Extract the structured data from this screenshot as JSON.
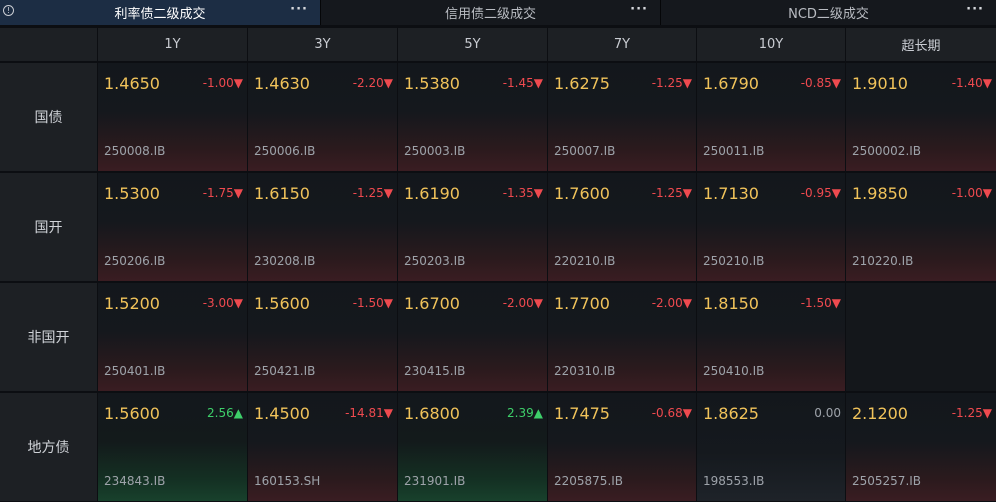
{
  "tabs": [
    {
      "label": "利率债二级成交",
      "active": true
    },
    {
      "label": "信用债二级成交",
      "active": false
    },
    {
      "label": "NCD二级成交",
      "active": false
    }
  ],
  "more_label": "···",
  "info_label": "!",
  "columns": [
    "1Y",
    "3Y",
    "5Y",
    "7Y",
    "10Y",
    "超长期"
  ],
  "rows": [
    {
      "label": "国债",
      "cells": [
        {
          "price": "1.4650",
          "change": "-1.00▼",
          "code": "250008.IB",
          "dir": "down"
        },
        {
          "price": "1.4630",
          "change": "-2.20▼",
          "code": "250006.IB",
          "dir": "down"
        },
        {
          "price": "1.5380",
          "change": "-1.45▼",
          "code": "250003.IB",
          "dir": "down"
        },
        {
          "price": "1.6275",
          "change": "-1.25▼",
          "code": "250007.IB",
          "dir": "down"
        },
        {
          "price": "1.6790",
          "change": "-0.85▼",
          "code": "250011.IB",
          "dir": "down"
        },
        {
          "price": "1.9010",
          "change": "-1.40▼",
          "code": "2500002.IB",
          "dir": "down"
        }
      ]
    },
    {
      "label": "国开",
      "cells": [
        {
          "price": "1.5300",
          "change": "-1.75▼",
          "code": "250206.IB",
          "dir": "down"
        },
        {
          "price": "1.6150",
          "change": "-1.25▼",
          "code": "230208.IB",
          "dir": "down"
        },
        {
          "price": "1.6190",
          "change": "-1.35▼",
          "code": "250203.IB",
          "dir": "down"
        },
        {
          "price": "1.7600",
          "change": "-1.25▼",
          "code": "220210.IB",
          "dir": "down"
        },
        {
          "price": "1.7130",
          "change": "-0.95▼",
          "code": "250210.IB",
          "dir": "down"
        },
        {
          "price": "1.9850",
          "change": "-1.00▼",
          "code": "210220.IB",
          "dir": "down"
        }
      ]
    },
    {
      "label": "非国开",
      "cells": [
        {
          "price": "1.5200",
          "change": "-3.00▼",
          "code": "250401.IB",
          "dir": "down"
        },
        {
          "price": "1.5600",
          "change": "-1.50▼",
          "code": "250421.IB",
          "dir": "down"
        },
        {
          "price": "1.6700",
          "change": "-2.00▼",
          "code": "230415.IB",
          "dir": "down"
        },
        {
          "price": "1.7700",
          "change": "-2.00▼",
          "code": "220310.IB",
          "dir": "down"
        },
        {
          "price": "1.8150",
          "change": "-1.50▼",
          "code": "250410.IB",
          "dir": "down"
        },
        {
          "price": "",
          "change": "",
          "code": "",
          "dir": "empty"
        }
      ]
    },
    {
      "label": "地方债",
      "cells": [
        {
          "price": "1.5600",
          "change": "2.56▲",
          "code": "234843.IB",
          "dir": "up"
        },
        {
          "price": "1.4500",
          "change": "-14.81▼",
          "code": "160153.SH",
          "dir": "down"
        },
        {
          "price": "1.6800",
          "change": "2.39▲",
          "code": "231901.IB",
          "dir": "up"
        },
        {
          "price": "1.7475",
          "change": "-0.68▼",
          "code": "2205875.IB",
          "dir": "down"
        },
        {
          "price": "1.8625",
          "change": "0.00",
          "code": "198553.IB",
          "dir": "flat"
        },
        {
          "price": "2.1200",
          "change": "-1.25▼",
          "code": "2505257.IB",
          "dir": "down"
        }
      ]
    }
  ],
  "colors": {
    "price": "#f1c35a",
    "down": "#f04a4f",
    "up": "#3ecf6a",
    "flat": "#9ea3aa",
    "active_tab": "#1c2d44"
  }
}
